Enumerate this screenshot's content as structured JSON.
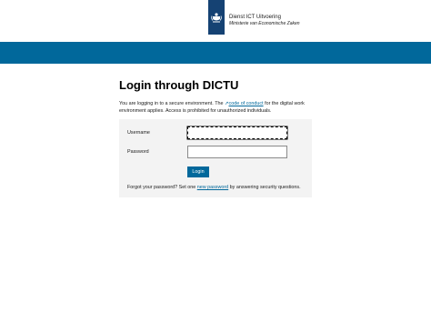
{
  "header": {
    "org_name": "Dienst ICT Uitvoering",
    "ministry": "Ministerie van Economische Zaken",
    "band_color": "#01689b",
    "logo_color": "#154273"
  },
  "main": {
    "title": "Login through DICTU",
    "intro_before_link": "You are logging in to a secure environment. The ",
    "intro_link": "code of conduct",
    "intro_after_link": " for the digital work environment applies. Access is prohibited for unauthorized individuals.",
    "external_link_icon": "external-link-icon"
  },
  "form": {
    "username_label": "Username",
    "username_value": "",
    "password_label": "Password",
    "password_value": "",
    "login_label": "Login",
    "forgot_before": "Forgot your password? Set one ",
    "forgot_link": "new password",
    "forgot_after": " by answering security questions."
  }
}
